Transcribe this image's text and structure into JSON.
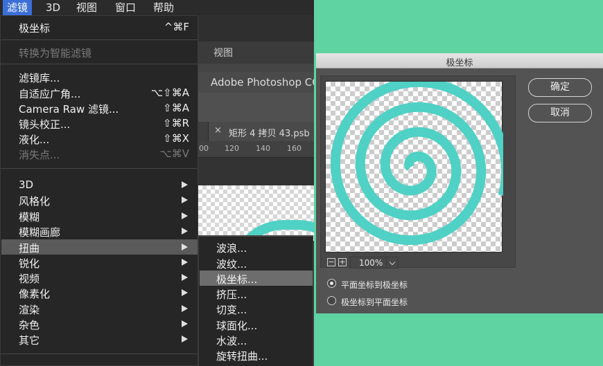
{
  "menubar": {
    "items": [
      {
        "label": "滤镜",
        "active": true
      },
      {
        "label": "3D"
      },
      {
        "label": "视图"
      },
      {
        "label": "窗口"
      },
      {
        "label": "帮助"
      }
    ]
  },
  "background_app": {
    "view_label": "视图",
    "app_title": "Adobe Photoshop CC",
    "tab_close": "×",
    "tab_title": "矩形 4 拷贝 43.psb",
    "ruler_ticks": [
      "00",
      "120",
      "140",
      "160"
    ]
  },
  "filter_menu": {
    "items": [
      {
        "label": "极坐标",
        "shortcut": "^⌘F"
      },
      {
        "label": "转换为智能滤镜",
        "disabled": true
      },
      {
        "label": "滤镜库..."
      },
      {
        "label": "自适应广角...",
        "shortcut": "⌥⇧⌘A"
      },
      {
        "label": "Camera Raw 滤镜...",
        "shortcut": "⇧⌘A"
      },
      {
        "label": "镜头校正...",
        "shortcut": "⇧⌘R"
      },
      {
        "label": "液化...",
        "shortcut": "⇧⌘X"
      },
      {
        "label": "消失点...",
        "shortcut": "⌥⌘V",
        "disabled": true
      },
      {
        "label": "3D",
        "submenu": true
      },
      {
        "label": "风格化",
        "submenu": true
      },
      {
        "label": "模糊",
        "submenu": true
      },
      {
        "label": "模糊画廊",
        "submenu": true
      },
      {
        "label": "扭曲",
        "submenu": true,
        "active": true
      },
      {
        "label": "锐化",
        "submenu": true
      },
      {
        "label": "视频",
        "submenu": true
      },
      {
        "label": "像素化",
        "submenu": true
      },
      {
        "label": "渲染",
        "submenu": true
      },
      {
        "label": "杂色",
        "submenu": true
      },
      {
        "label": "其它",
        "submenu": true
      }
    ]
  },
  "distort_submenu": {
    "items": [
      {
        "label": "波浪..."
      },
      {
        "label": "波纹..."
      },
      {
        "label": "极坐标...",
        "active": true
      },
      {
        "label": "挤压..."
      },
      {
        "label": "切变..."
      },
      {
        "label": "球面化..."
      },
      {
        "label": "水波..."
      },
      {
        "label": "旋转扭曲..."
      }
    ]
  },
  "dialog": {
    "title": "极坐标",
    "ok_label": "确定",
    "cancel_label": "取消",
    "zoom_out": "−",
    "zoom_in": "+",
    "zoom_value": "100%",
    "options": [
      {
        "label": "平面坐标到极坐标",
        "selected": true
      },
      {
        "label": "极坐标到平面坐标",
        "selected": false
      }
    ],
    "accent_color": "#4fd1c5"
  },
  "colors": {
    "desktop_bg": "#5fd3a2",
    "menu_bg": "#262626",
    "menubar_active": "#3b6fd8"
  }
}
